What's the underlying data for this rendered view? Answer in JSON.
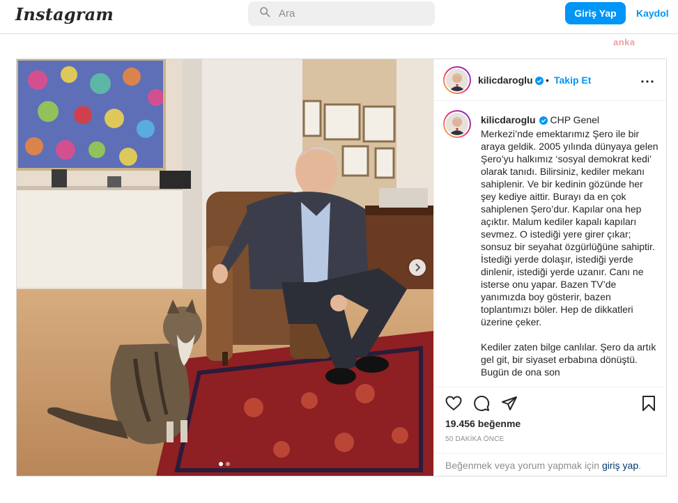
{
  "header": {
    "logo": "Instagram",
    "search_placeholder": "Ara",
    "login_label": "Giriş Yap",
    "signup_label": "Kaydol"
  },
  "watermark": "anka",
  "post": {
    "username": "kilicdaroglu",
    "follow_label": "Takip Et",
    "bullet": "•",
    "caption_text": "CHP Genel\nMerkezi’nde emektarımız Şero ile bir araya geldik. 2005 yılında dünyaya gelen Şero’yu halkımız ‘sosyal demokrat kedi’ olarak tanıdı. Bilirsiniz, kediler mekanı sahiplenir. Ve bir kedinin gözünde her şey kediye aittir. Burayı da en çok sahiplenen Şero’dur. Kapılar ona hep açıktır. Malum kediler kapalı kapıları sevmez. O istediği yere girer çıkar; sonsuz bir seyahat özgürlüğüne sahiptir. İstediği yerde dolaşır, istediği yerde dinlenir, istediği yerde uzanır. Canı ne isterse onu yapar. Bazen TV’de yanımızda boy gösterir, bazen toplantımızı böler. Hep de dikkatleri üzerine çeker.\n\nKediler zaten bilge canlılar. Şero da artık gel git, bir siyaset erbabına dönüştü. Bugün de ona son",
    "likes": "19.456 beğenme",
    "time": "50 DAKİKA ÖNCE",
    "login_prompt": "Beğenmek veya yorum yapmak için",
    "login_link": "giriş yap",
    "login_suffix": ".",
    "carousel": {
      "current": 1,
      "total": 2
    }
  },
  "icons": {
    "search": "search-icon",
    "verified": "verified-badge-icon",
    "more": "more-options-icon",
    "like": "heart-icon",
    "comment": "comment-icon",
    "share": "share-icon",
    "save": "bookmark-icon",
    "next": "chevron-right-icon"
  },
  "colors": {
    "accent": "#0095f6",
    "verified": "#0095f6",
    "link": "#00376b",
    "muted": "#8e8e8e",
    "border": "#dbdbdb"
  }
}
